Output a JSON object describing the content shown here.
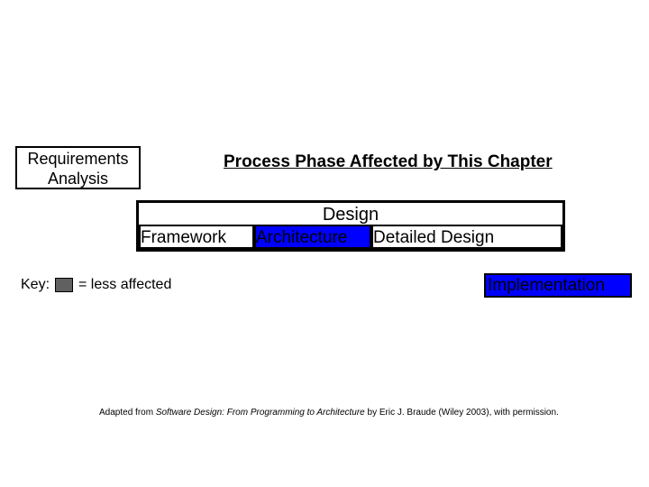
{
  "title": "Process Phase Affected by This Chapter",
  "phases": {
    "requirements": "Requirements\nAnalysis",
    "design_header": "Design",
    "framework": "Framework",
    "architecture": "Architecture",
    "detailed": "Detailed Design",
    "implementation": "Implementation"
  },
  "key": {
    "label": "Key:",
    "explanation": "= less affected"
  },
  "attribution": {
    "prefix": "Adapted from ",
    "book": "Software Design: From Programming to Architecture",
    "suffix": " by Eric J. Braude (Wiley 2003), with permission."
  }
}
